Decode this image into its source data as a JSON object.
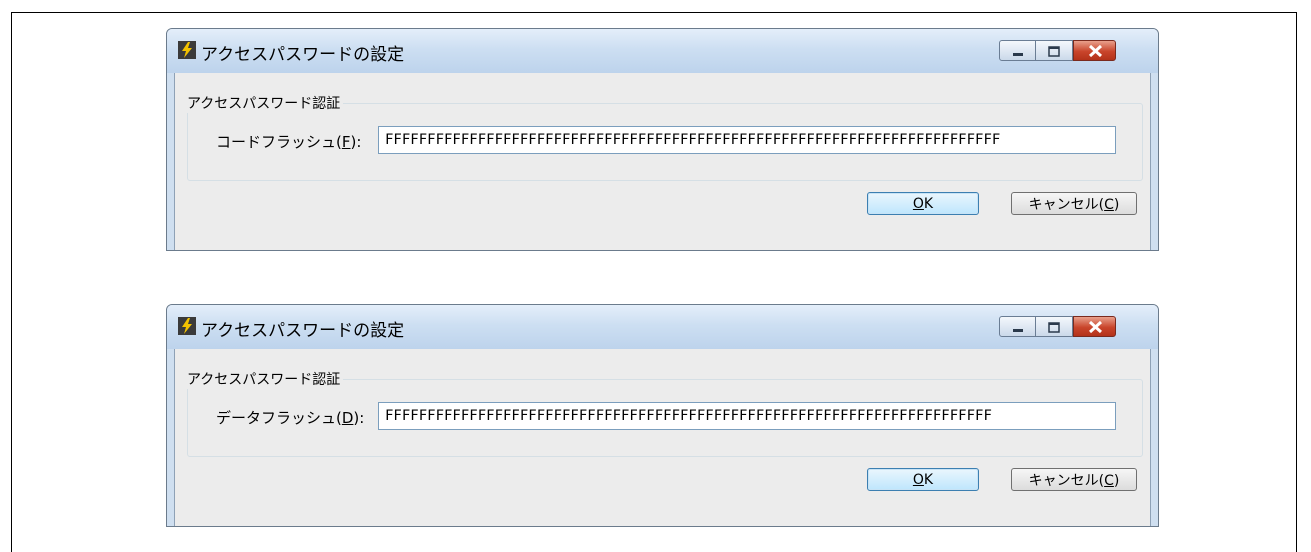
{
  "dialogs": [
    {
      "title": "アクセスパスワードの設定",
      "group_label": "アクセスパスワード認証",
      "field_label_prefix": "コードフラッシュ(",
      "field_label_key": "F",
      "field_label_suffix": "):",
      "field_value": "FFFFFFFFFFFFFFFFFFFFFFFFFFFFFFFFFFFFFFFFFFFFFFFFFFFFFFFFFFFFFFFFFFFFFFFFF",
      "ok_key": "O",
      "ok_rest": "K",
      "cancel_prefix": "キャンセル(",
      "cancel_key": "C",
      "cancel_suffix": ")"
    },
    {
      "title": "アクセスパスワードの設定",
      "group_label": "アクセスパスワード認証",
      "field_label_prefix": "データフラッシュ(",
      "field_label_key": "D",
      "field_label_suffix": "):",
      "field_value": "FFFFFFFFFFFFFFFFFFFFFFFFFFFFFFFFFFFFFFFFFFFFFFFFFFFFFFFFFFFFFFFFFFFFFFFF",
      "ok_key": "O",
      "ok_rest": "K",
      "cancel_prefix": "キャンセル(",
      "cancel_key": "C",
      "cancel_suffix": ")"
    }
  ],
  "colors": {
    "titlebar": "#cddff2",
    "close_button": "#c9452b",
    "client_bg": "#ececec"
  },
  "icons": [
    "app-icon",
    "minimize-icon",
    "maximize-icon",
    "close-icon"
  ]
}
